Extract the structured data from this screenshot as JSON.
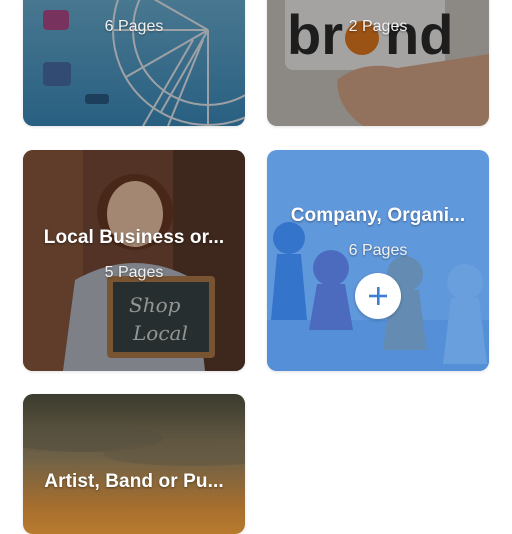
{
  "cards": [
    {
      "title": "",
      "pages": "6 Pages"
    },
    {
      "title": "",
      "pages": "2 Pages"
    },
    {
      "title": "Local Business or...",
      "pages": "5 Pages"
    },
    {
      "title": "Company, Organi...",
      "pages": "6 Pages"
    },
    {
      "title": "Artist, Band or Pu...",
      "pages": ""
    }
  ],
  "add_icon": "plus-icon",
  "colors": {
    "accent": "#3d7fd4",
    "selected_overlay": "#4a8be0"
  }
}
